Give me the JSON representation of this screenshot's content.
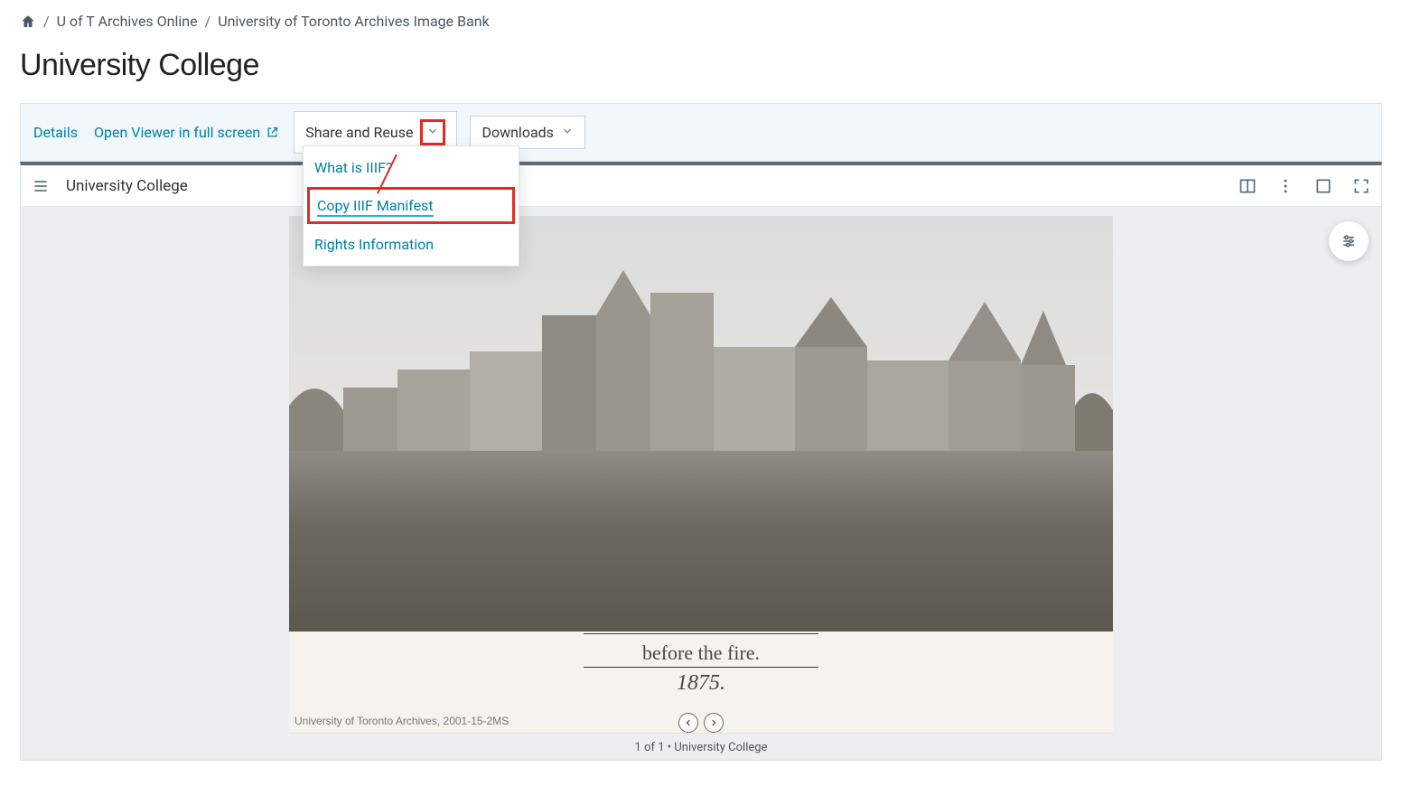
{
  "breadcrumb": {
    "items": [
      {
        "label": "U of T Archives Online"
      },
      {
        "label": "University of Toronto Archives Image Bank"
      }
    ]
  },
  "page": {
    "title": "University College"
  },
  "toolbar": {
    "details_label": "Details",
    "open_viewer_label": "Open Viewer in full screen",
    "share_reuse_label": "Share and Reuse",
    "downloads_label": "Downloads"
  },
  "share_menu": {
    "items": [
      {
        "label": "What is IIIF?"
      },
      {
        "label": "Copy IIIF Manifest"
      },
      {
        "label": "Rights Information"
      }
    ]
  },
  "viewer": {
    "title": "University College",
    "caption_line1": "before the fire.",
    "caption_year": "1875.",
    "credit": "University of Toronto Archives, 2001-15-2MS",
    "page_indicator": "1 of 1  •  University College"
  }
}
